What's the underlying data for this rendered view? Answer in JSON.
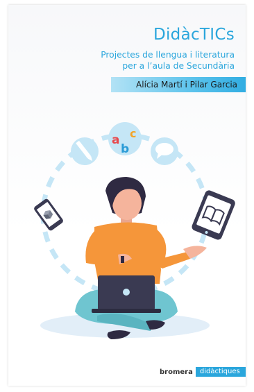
{
  "book": {
    "title": "DidàcTICs",
    "subtitle_line1": "Projectes de llengua i literatura",
    "subtitle_line2": "per a l’aula de Secundària",
    "authors": "Alícia Martí i Pilar Garcia",
    "publisher": "bromera",
    "collection": "didàctiques"
  },
  "illustration": {
    "abc_letters": [
      "a",
      "b",
      "c"
    ],
    "icons": [
      "pencil-icon",
      "abc-letters-icon",
      "speech-bubble-icon",
      "tablet-book-icon",
      "phone-cube-icon",
      "laptop-icon"
    ]
  },
  "colors": {
    "accent": "#2aa6dc",
    "letter_a": "#e8474b",
    "letter_b": "#2a9bd6",
    "letter_c": "#f3a426",
    "shirt": "#f5963a",
    "skin": "#f5b49c",
    "hair": "#2f2a42",
    "pants": "#6fc5d0",
    "laptop": "#3a3a52"
  }
}
